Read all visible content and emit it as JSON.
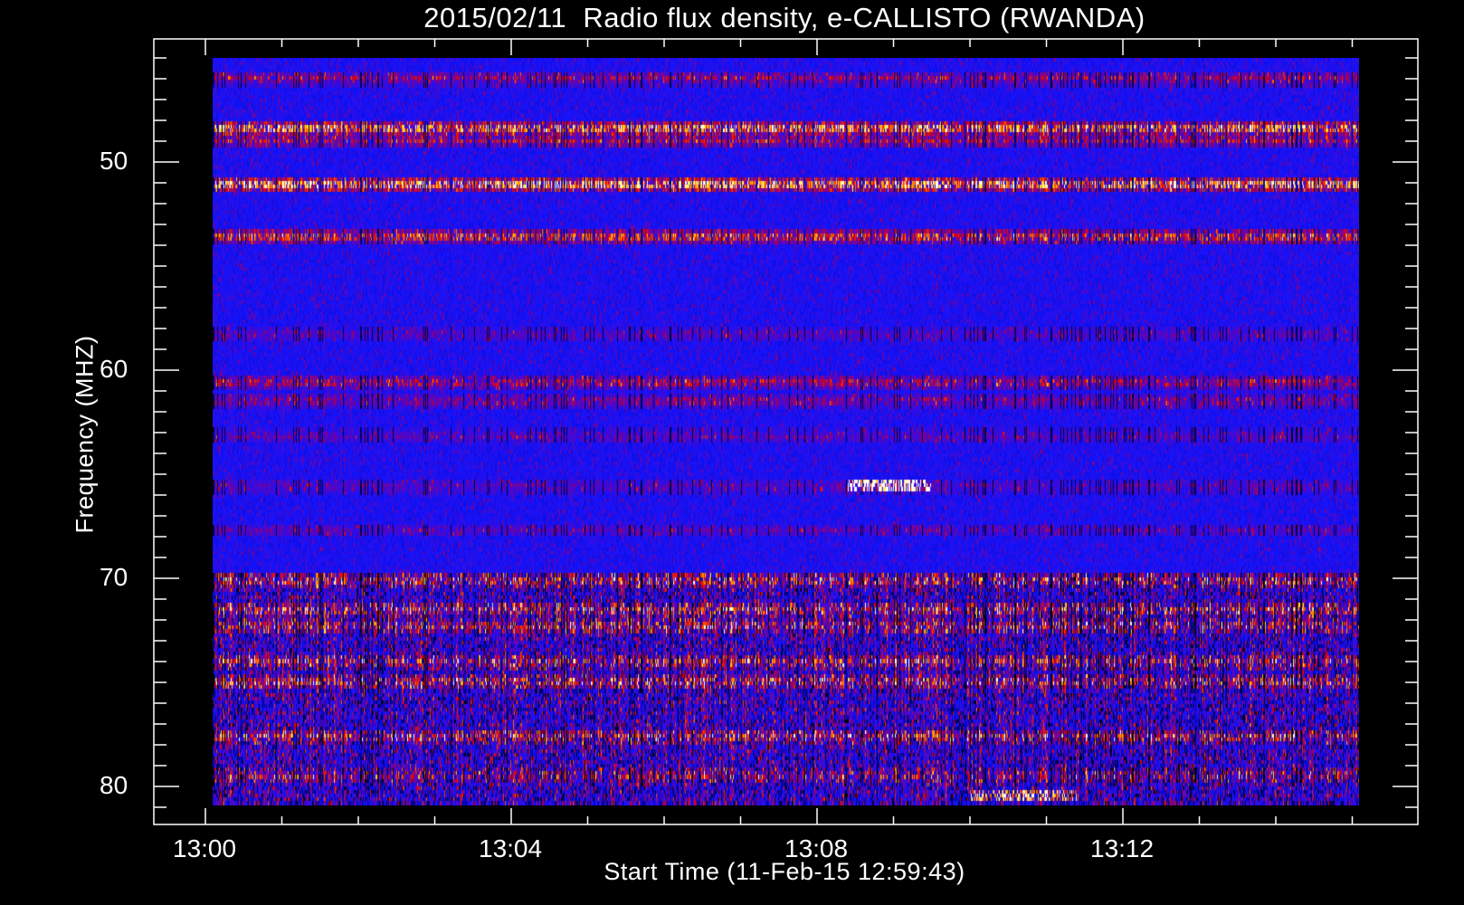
{
  "chart_data": {
    "type": "heatmap",
    "title": "2015/02/11  Radio flux density, e-CALLISTO (RWANDA)",
    "xlabel": "Start Time (11-Feb-15 12:59:43)",
    "ylabel": "Frequency (MHZ)",
    "x_unit": "minutes after 13:00 UT",
    "xlim": [
      0,
      16.5
    ],
    "data_xrange": [
      0.1,
      15.1
    ],
    "ylim": [
      44.1,
      81.7
    ],
    "data_yrange": [
      45,
      80.9
    ],
    "y_inverted": true,
    "x_major_ticks": [
      {
        "value": 0,
        "label": "13:00"
      },
      {
        "value": 4,
        "label": "13:04"
      },
      {
        "value": 8,
        "label": "13:08"
      },
      {
        "value": 12,
        "label": "13:12"
      }
    ],
    "x_minor_step": 1,
    "y_major_ticks": [
      {
        "value": 50,
        "label": "50"
      },
      {
        "value": 60,
        "label": "60"
      },
      {
        "value": 70,
        "label": "70"
      },
      {
        "value": 80,
        "label": "80"
      }
    ],
    "y_minor_step": 1,
    "colormap": [
      "#000000",
      "#0000ff",
      "#ff0000",
      "#ffcc00",
      "#ffffff"
    ],
    "background_level": 0.42,
    "bands": [
      {
        "freq": 46.0,
        "strength": 0.25
      },
      {
        "freq": 48.4,
        "strength": 0.55
      },
      {
        "freq": 49.0,
        "strength": 0.3
      },
      {
        "freq": 51.1,
        "strength": 0.6
      },
      {
        "freq": 53.6,
        "strength": 0.42
      },
      {
        "freq": 58.3,
        "strength": 0.15
      },
      {
        "freq": 60.6,
        "strength": 0.3
      },
      {
        "freq": 61.5,
        "strength": 0.22
      },
      {
        "freq": 63.2,
        "strength": 0.15
      },
      {
        "freq": 65.6,
        "strength": 0.15
      },
      {
        "freq": 67.7,
        "strength": 0.15
      },
      {
        "freq": 70.1,
        "strength": 0.3
      },
      {
        "freq": 71.5,
        "strength": 0.32
      },
      {
        "freq": 72.3,
        "strength": 0.3
      },
      {
        "freq": 74.0,
        "strength": 0.28
      },
      {
        "freq": 75.0,
        "strength": 0.32
      },
      {
        "freq": 77.6,
        "strength": 0.3
      },
      {
        "freq": 79.5,
        "strength": 0.2
      }
    ],
    "noisy_region": {
      "freq_from": 69.8,
      "freq_to": 80.9
    },
    "bursts": [
      {
        "t_from": 8.4,
        "t_to": 9.5,
        "freq": 65.5,
        "strength": 0.55
      },
      {
        "t_from": 10.0,
        "t_to": 11.4,
        "freq": 80.4,
        "strength": 0.45
      }
    ]
  }
}
